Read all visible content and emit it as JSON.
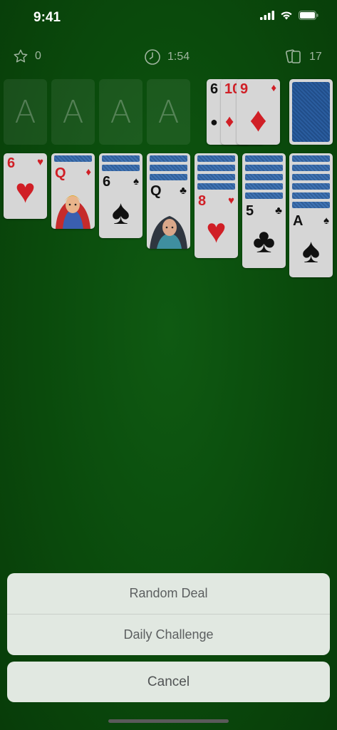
{
  "status_bar": {
    "time": "9:41"
  },
  "top_bar": {
    "score": "0",
    "timer": "1:54",
    "stock_count": "17"
  },
  "foundation": {
    "placeholder": "A"
  },
  "waste": [
    {
      "rank": "6",
      "suit": "●"
    },
    {
      "rank": "10",
      "suit": "♦"
    },
    {
      "rank": "9",
      "suit": "♦"
    }
  ],
  "tableau": [
    {
      "rank": "6",
      "suit": "♥"
    },
    {
      "rank": "Q",
      "suit": "♦"
    },
    {
      "rank": "6",
      "suit": "♠"
    },
    {
      "rank": "Q",
      "suit": "♣"
    },
    {
      "rank": "8",
      "suit": "♥"
    },
    {
      "rank": "5",
      "suit": "♣"
    },
    {
      "rank": "A",
      "suit": "♠"
    }
  ],
  "action_sheet": {
    "options": [
      "Random Deal",
      "Daily Challenge"
    ],
    "cancel": "Cancel"
  },
  "colors": {
    "felt": "#0a4a0c",
    "red_suit": "#d01f26",
    "card_back": "#2a5d9f"
  }
}
